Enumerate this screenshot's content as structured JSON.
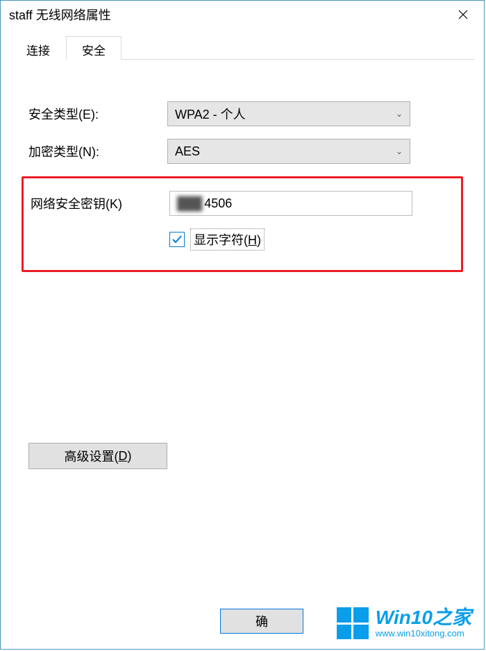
{
  "window": {
    "title": "staff 无线网络属性"
  },
  "tabs": {
    "connection": "连接",
    "security": "安全"
  },
  "labels": {
    "security_type": "安全类型(E):",
    "encryption_type": "加密类型(N):",
    "network_key": "网络安全密钥(K)",
    "show_chars_prefix": "显示字符(",
    "show_chars_hotkey": "H",
    "show_chars_suffix": ")",
    "advanced_prefix": "高级设置(",
    "advanced_hotkey": "D",
    "advanced_suffix": ")"
  },
  "values": {
    "security_type": "WPA2 - 个人",
    "encryption_type": "AES",
    "network_key_hidden": "███",
    "network_key_visible": "4506",
    "show_chars_checked": true
  },
  "buttons": {
    "ok": "确"
  },
  "watermark": {
    "title": "Win10之家",
    "url": "www.win10xitong.com"
  }
}
